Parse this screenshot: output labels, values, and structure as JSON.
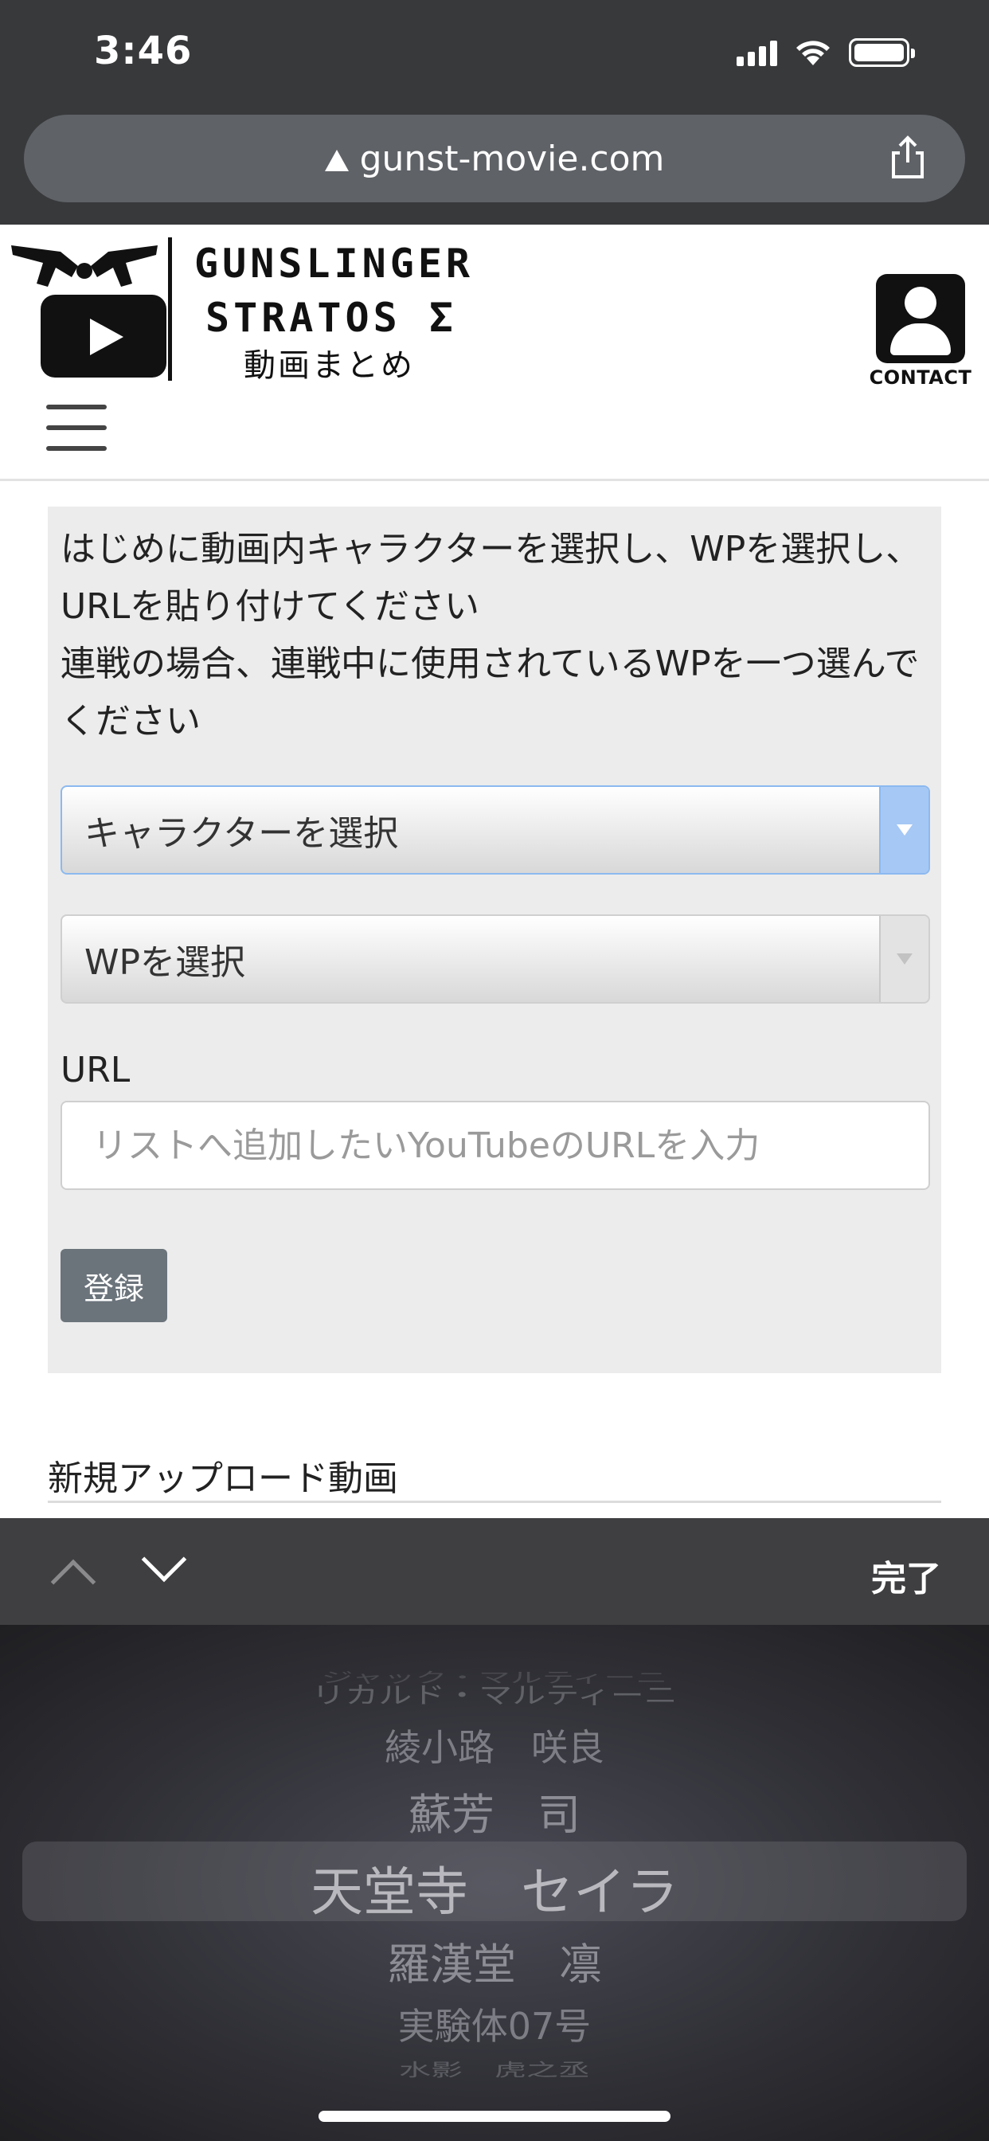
{
  "status_bar": {
    "time": "3:46"
  },
  "browser": {
    "url": "gunst-movie.com"
  },
  "site": {
    "logo_line1": "GUNSLINGER",
    "logo_line2": "STRATOS Σ",
    "logo_line3": "動画まとめ",
    "contact_label": "CONTACT"
  },
  "form": {
    "intro_line1": "はじめに動画内キャラクターを選択し、WPを選択し、URLを貼り付けてください",
    "intro_line2": "連戦の場合、連戦中に使用されているWPを一つ選んでください",
    "character_select": "キャラクターを選択",
    "wp_select": "WPを選択",
    "url_label": "URL",
    "url_placeholder": "リストへ追加したいYouTubeのURLを入力",
    "submit_label": "登録"
  },
  "section_title": "新規アップロード動画",
  "picker": {
    "done_label": "完了",
    "items": [
      "ジャック・マルティーニ",
      "リカルド・マルティーニ",
      "綾小路　咲良",
      "蘇芳　司",
      "天堂寺　セイラ",
      "羅漢堂　凛",
      "実験体07号",
      "水影　虎之丞"
    ],
    "selected_index": 4
  }
}
